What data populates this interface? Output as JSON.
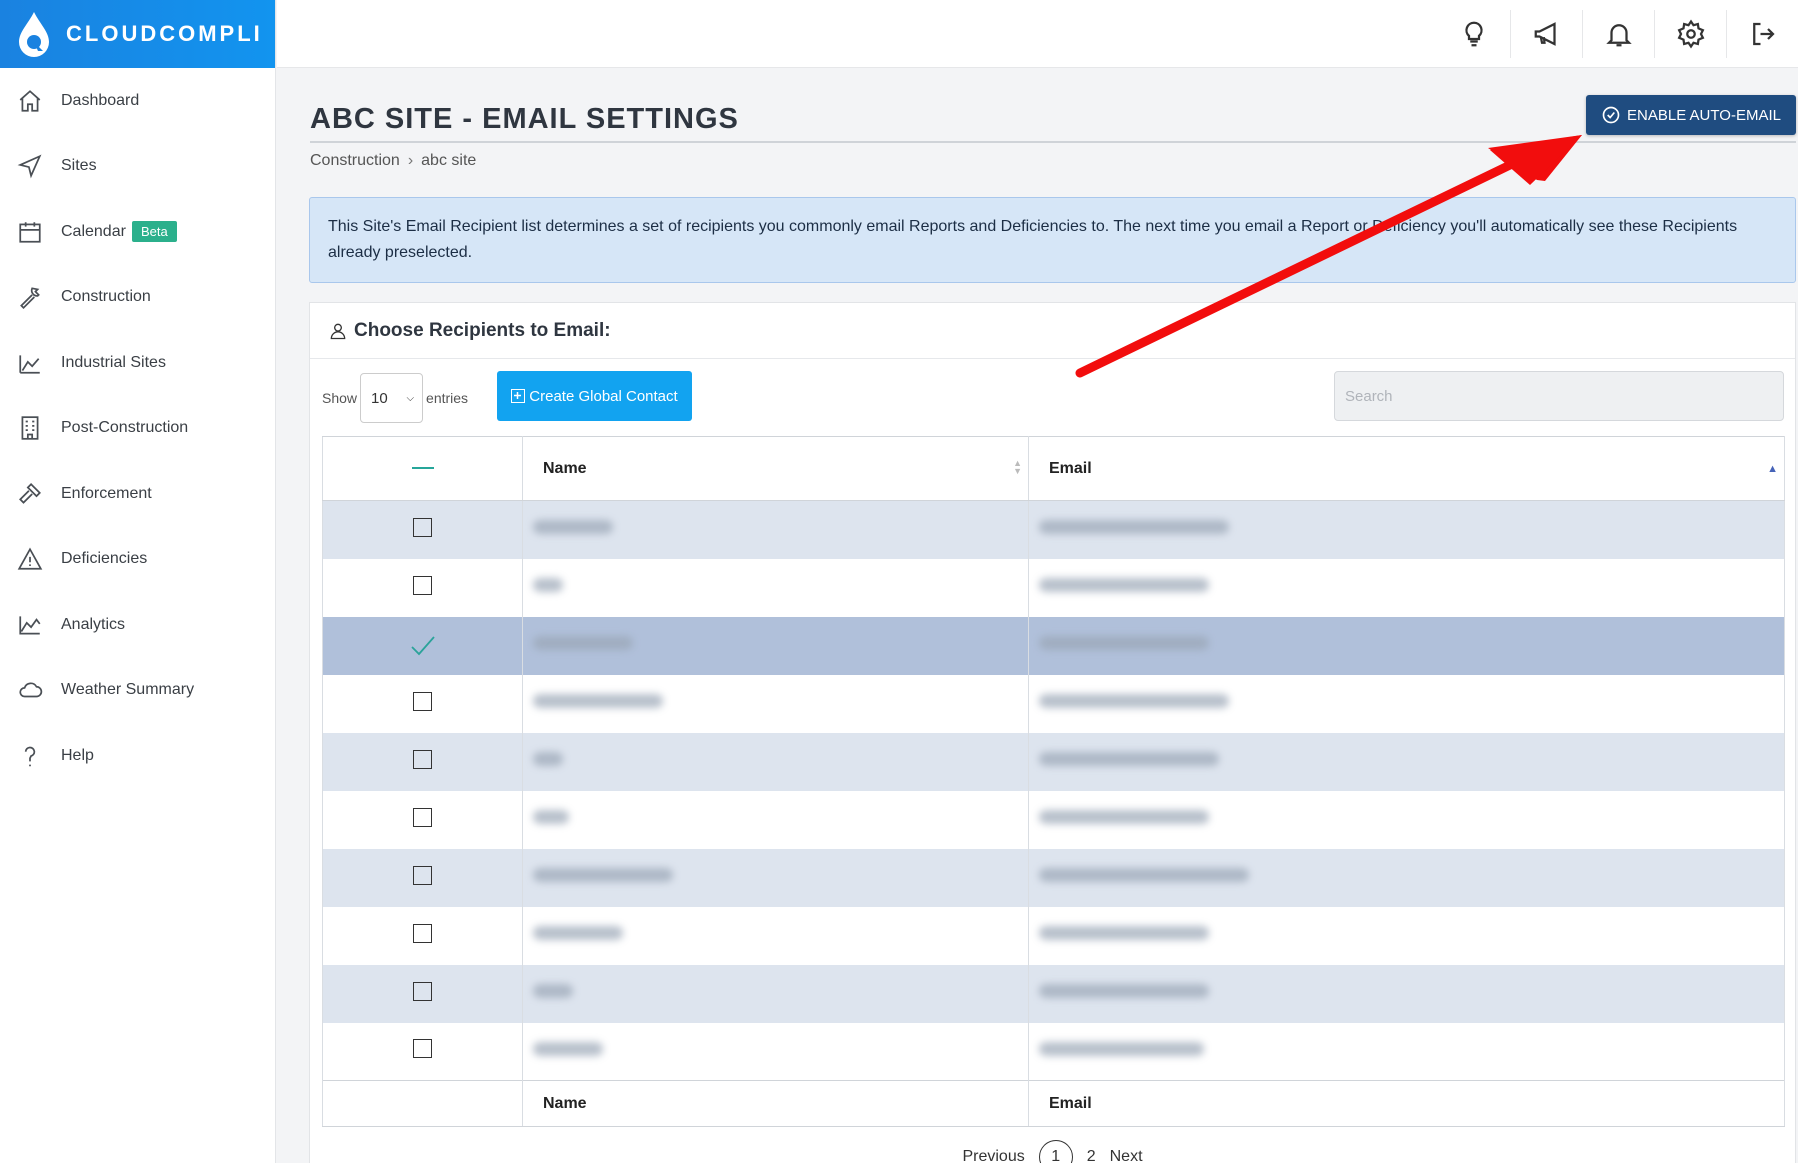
{
  "brand": {
    "name": "CLOUDCOMPLI"
  },
  "sidebar": {
    "items": [
      {
        "label": "Dashboard",
        "icon": "home-icon"
      },
      {
        "label": "Sites",
        "icon": "navigation-icon"
      },
      {
        "label": "Calendar",
        "icon": "calendar-icon",
        "badge": "Beta"
      },
      {
        "label": "Construction",
        "icon": "wrench-icon"
      },
      {
        "label": "Industrial Sites",
        "icon": "factory-icon"
      },
      {
        "label": "Post-Construction",
        "icon": "building-icon"
      },
      {
        "label": "Enforcement",
        "icon": "gavel-icon"
      },
      {
        "label": "Deficiencies",
        "icon": "warning-icon"
      },
      {
        "label": "Analytics",
        "icon": "chart-icon"
      },
      {
        "label": "Weather Summary",
        "icon": "cloud-icon"
      },
      {
        "label": "Help",
        "icon": "help-icon"
      }
    ]
  },
  "topbar": {
    "icons": [
      "lightbulb-icon",
      "megaphone-icon",
      "bell-icon",
      "gear-icon",
      "logout-icon"
    ]
  },
  "page": {
    "title": "ABC SITE - EMAIL SETTINGS",
    "breadcrumb": [
      "Construction",
      "abc site"
    ],
    "breadcrumb_sep": "›",
    "enable_button": "ENABLE AUTO-EMAIL",
    "info": "This Site's Email Recipient list determines a set of recipients you commonly email Reports and Deficiencies to. The next time you email a Report or Deficiency you'll automatically see these Recipients already preselected."
  },
  "card": {
    "title": "Choose Recipients to Email:",
    "show_label": "Show",
    "entries_value": "10",
    "entries_label": "entries",
    "create_button": "Create Global Contact",
    "search_placeholder": "Search"
  },
  "table": {
    "columns": [
      "Name",
      "Email"
    ],
    "rows": [
      {
        "checked": false
      },
      {
        "checked": false
      },
      {
        "checked": true
      },
      {
        "checked": false
      },
      {
        "checked": false
      },
      {
        "checked": false
      },
      {
        "checked": false
      },
      {
        "checked": false
      },
      {
        "checked": false
      },
      {
        "checked": false
      }
    ]
  },
  "pager": {
    "previous": "Previous",
    "pages": [
      "1",
      "2"
    ],
    "next": "Next"
  },
  "colors": {
    "accent": "#1294ef",
    "primary_button": "#1f4c80",
    "annotation_arrow": "#f20d0d"
  }
}
